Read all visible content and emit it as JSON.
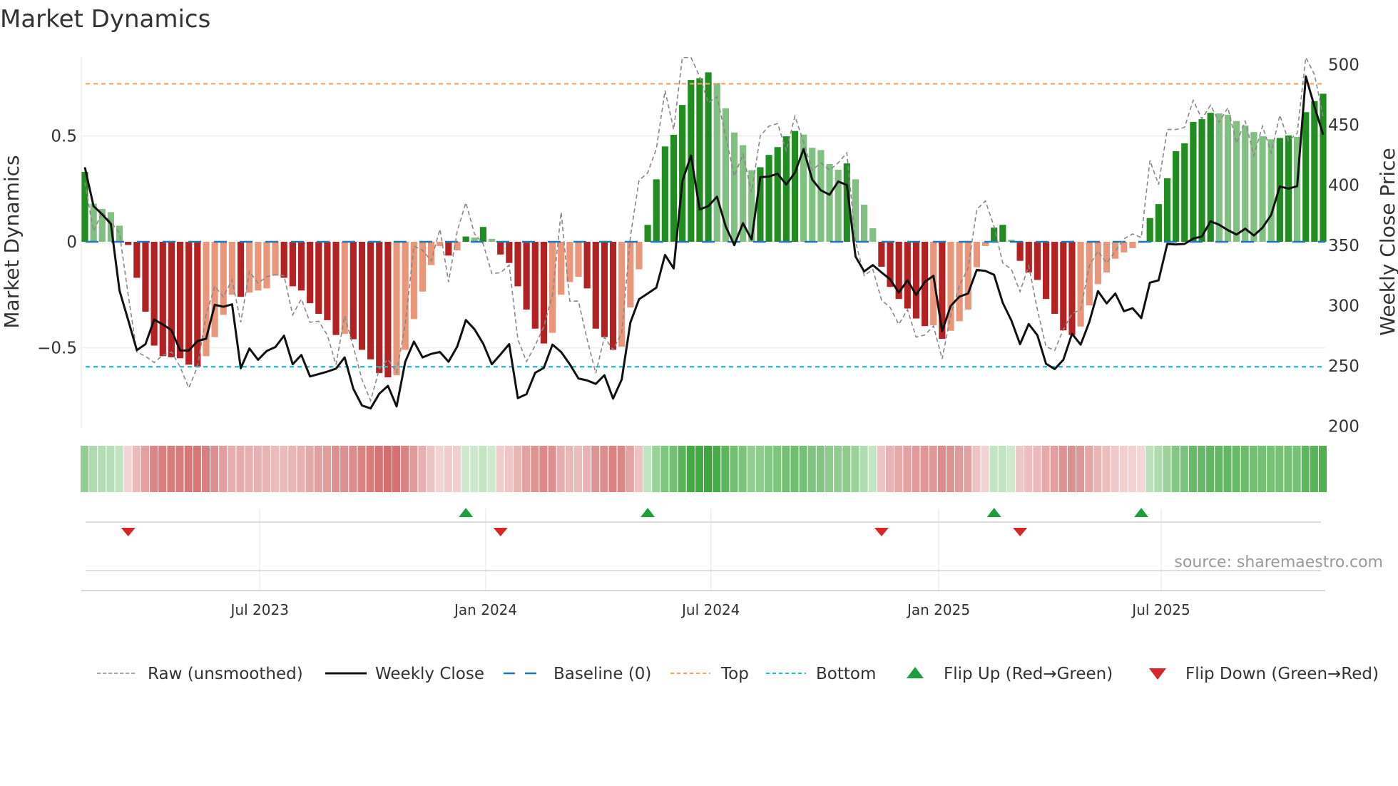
{
  "chart_data": {
    "type": "bar",
    "title": "Market Dynamics",
    "ylabel": "Market Dynamics",
    "y2label": "Weekly Close Price",
    "xlabel": "",
    "x_unit": "week index (weekly bars, starting ~Feb 2023)",
    "ylim": [
      -0.88,
      0.865
    ],
    "y2lim": [
      198.5,
      505
    ],
    "yticks": [
      {
        "value": 0.5,
        "label": "0.5"
      },
      {
        "value": 0,
        "label": "0"
      },
      {
        "value": -0.5,
        "label": "−0.5"
      }
    ],
    "y2ticks": [
      {
        "value": 500,
        "label": "500"
      },
      {
        "value": 450,
        "label": "450"
      },
      {
        "value": 400,
        "label": "400"
      },
      {
        "value": 350,
        "label": "350"
      },
      {
        "value": 300,
        "label": "300"
      },
      {
        "value": 250,
        "label": "250"
      },
      {
        "value": 200,
        "label": "200"
      }
    ],
    "xticks": [
      {
        "week": 20.2,
        "label": "Jul 2023"
      },
      {
        "week": 46.3,
        "label": "Jan 2024"
      },
      {
        "week": 72.3,
        "label": "Jul 2024"
      },
      {
        "week": 98.6,
        "label": "Jan 2025"
      },
      {
        "week": 124.3,
        "label": "Jul 2025"
      }
    ],
    "top_level": 0.746,
    "bottom_level": -0.59,
    "baseline": 0,
    "dynamics": [
      0.33,
      0.18,
      0.155,
      0.14,
      0.076,
      -0.015,
      -0.17,
      -0.33,
      -0.49,
      -0.54,
      -0.545,
      -0.55,
      -0.58,
      -0.59,
      -0.54,
      -0.45,
      -0.345,
      -0.25,
      -0.26,
      -0.24,
      -0.23,
      -0.22,
      -0.16,
      -0.17,
      -0.21,
      -0.23,
      -0.29,
      -0.34,
      -0.37,
      -0.44,
      -0.435,
      -0.46,
      -0.51,
      -0.555,
      -0.62,
      -0.64,
      -0.63,
      -0.51,
      -0.365,
      -0.235,
      -0.11,
      -0.02,
      -0.065,
      -0.04,
      0.025,
      0.02,
      0.07,
      0.014,
      -0.06,
      -0.1,
      -0.21,
      -0.32,
      -0.41,
      -0.48,
      -0.43,
      -0.25,
      -0.19,
      -0.165,
      -0.22,
      -0.41,
      -0.45,
      -0.51,
      -0.495,
      -0.31,
      -0.13,
      0.08,
      0.295,
      0.45,
      0.505,
      0.646,
      0.764,
      0.772,
      0.8,
      0.75,
      0.63,
      0.516,
      0.456,
      0.338,
      0.352,
      0.41,
      0.447,
      0.498,
      0.523,
      0.506,
      0.444,
      0.433,
      0.367,
      0.34,
      0.37,
      0.295,
      0.175,
      0.064,
      -0.118,
      -0.213,
      -0.27,
      -0.315,
      -0.362,
      -0.398,
      -0.394,
      -0.458,
      -0.42,
      -0.375,
      -0.32,
      -0.12,
      -0.02,
      0.067,
      0.08,
      0.01,
      -0.09,
      -0.145,
      -0.18,
      -0.27,
      -0.34,
      -0.418,
      -0.44,
      -0.4,
      -0.3,
      -0.2,
      -0.145,
      -0.08,
      -0.05,
      -0.03,
      -0.005,
      0.112,
      0.178,
      0.3,
      0.428,
      0.465,
      0.566,
      0.579,
      0.609,
      0.606,
      0.6,
      0.57,
      0.549,
      0.518,
      0.498,
      0.484,
      0.49,
      0.502,
      0.495,
      0.612,
      0.664,
      0.699
    ],
    "raw": [
      0.28,
      0.05,
      0.14,
      0.095,
      0.04,
      -0.25,
      -0.52,
      -0.54,
      -0.57,
      -0.535,
      -0.52,
      -0.59,
      -0.69,
      -0.59,
      -0.345,
      -0.21,
      -0.26,
      -0.18,
      -0.38,
      -0.14,
      -0.195,
      -0.165,
      -0.155,
      -0.16,
      -0.345,
      -0.27,
      -0.38,
      -0.375,
      -0.44,
      -0.58,
      -0.35,
      -0.495,
      -0.65,
      -0.75,
      -0.6,
      -0.555,
      -0.617,
      -0.39,
      -0.02,
      -0.04,
      -0.09,
      0.06,
      -0.19,
      0.05,
      0.185,
      0.037,
      -0.01,
      -0.15,
      -0.146,
      -0.11,
      -0.46,
      -0.565,
      -0.49,
      -0.4,
      -0.25,
      0.14,
      -0.28,
      -0.28,
      -0.46,
      -0.62,
      -0.45,
      -0.51,
      -0.43,
      0.025,
      0.29,
      0.326,
      0.44,
      0.714,
      0.53,
      0.87,
      0.87,
      0.78,
      0.656,
      0.685,
      0.5,
      0.31,
      0.413,
      0.234,
      0.5,
      0.546,
      0.558,
      0.43,
      0.593,
      0.471,
      0.338,
      0.373,
      0.338,
      0.373,
      0.42,
      0,
      -0.16,
      -0.13,
      -0.275,
      -0.31,
      -0.39,
      -0.32,
      -0.45,
      -0.44,
      -0.397,
      -0.553,
      -0.345,
      -0.206,
      -0.125,
      0.153,
      0.193,
      0.072,
      -0.1,
      -0.13,
      -0.235,
      -0.113,
      -0.32,
      -0.495,
      -0.513,
      -0.414,
      -0.34,
      -0.32,
      -0.113,
      -0.044,
      -0.1,
      -0.044,
      0.014,
      0.037,
      0.02,
      0.384,
      0.27,
      0.53,
      0.53,
      0.54,
      0.668,
      0.58,
      0.645,
      0.564,
      0.633,
      0.465,
      0.57,
      0.407,
      0.546,
      0.42,
      0.598,
      0.477,
      0.512,
      0.87,
      0.79,
      0.593
    ],
    "weekly_close": [
      414.7,
      382.5,
      375.6,
      367.8,
      312.4,
      288,
      263,
      268,
      288.4,
      284.3,
      279.5,
      262.7,
      262.7,
      270.5,
      272.5,
      300.6,
      299,
      301,
      248,
      264.4,
      255,
      262.3,
      265.6,
      275,
      251.3,
      259,
      241.2,
      243.2,
      245.2,
      247.7,
      257,
      231,
      217.1,
      214.7,
      226.9,
      233.4,
      216.3,
      253.4,
      270.1,
      257,
      259.9,
      261.5,
      253.4,
      266,
      288,
      280.3,
      268.4,
      251.3,
      259.5,
      268,
      223.2,
      226.5,
      244.2,
      248.3,
      267.6,
      261.5,
      251.3,
      239.5,
      237.9,
      235,
      242.2,
      222.8,
      238.7,
      286,
      305.3,
      310,
      314.9,
      342,
      330.8,
      403.1,
      424.5,
      379.7,
      382.5,
      390.3,
      365.8,
      350.1,
      368.3,
      354.8,
      406.5,
      407,
      409.4,
      400.4,
      410.2,
      429.8,
      404.5,
      395.6,
      391.9,
      402.9,
      400,
      340.6,
      328.3,
      333.6,
      327.5,
      321.8,
      310.8,
      321,
      308.8,
      319.6,
      324.7,
      278.8,
      299.8,
      307.4,
      310,
      329.6,
      328.7,
      325.5,
      302.3,
      287.6,
      268,
      284.7,
      275.4,
      251.7,
      247.3,
      255,
      276.6,
      267.6,
      286.4,
      312,
      301.8,
      310,
      295.3,
      297.8,
      289.6,
      319,
      321,
      351.1,
      350.7,
      351.1,
      355.6,
      357.3,
      369.9,
      367,
      362.6,
      358.9,
      363.8,
      358.1,
      364.6,
      375.2,
      398.8,
      397,
      399,
      490.1,
      465.2,
      441.8
    ],
    "flip_up_weeks": [
      44,
      65,
      105,
      122
    ],
    "flip_down_weeks": [
      5,
      48,
      92,
      108
    ],
    "legend": {
      "placement": "bottom",
      "items": [
        {
          "key": "raw",
          "label": "Raw (unsmoothed)"
        },
        {
          "key": "close",
          "label": "Weekly Close"
        },
        {
          "key": "baseline",
          "label": "Baseline (0)"
        },
        {
          "key": "top",
          "label": "Top"
        },
        {
          "key": "bottom",
          "label": "Bottom"
        },
        {
          "key": "flip_up",
          "label": "Flip Up (Red→Green)"
        },
        {
          "key": "flip_down",
          "label": "Flip Down (Green→Red)"
        }
      ]
    },
    "source": "source: sharemaestro.com",
    "colors": {
      "pos_strong": "#228b22",
      "pos_weak": "#80c080",
      "neg_strong": "#b22222",
      "neg_weak": "#e9967a",
      "raw": "#888888",
      "close": "#111111",
      "baseline": "#1f77b4",
      "top": "#f4a460",
      "bottom": "#17becf",
      "flip_up": "#1f9e3f",
      "flip_down": "#d62728"
    }
  }
}
